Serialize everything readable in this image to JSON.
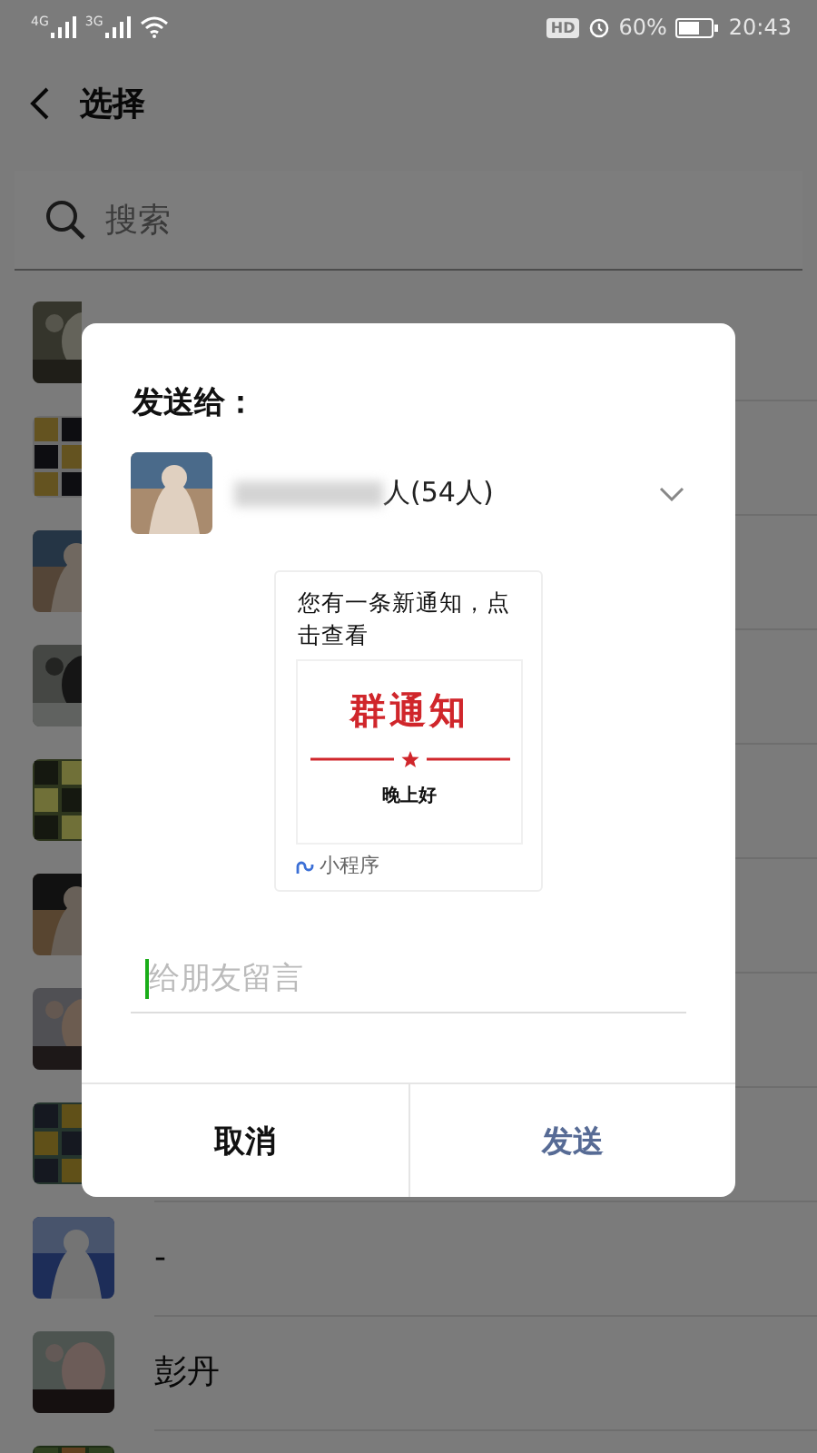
{
  "status_bar": {
    "networks": [
      {
        "label": "4G"
      },
      {
        "label": "3G"
      }
    ],
    "hd": "HD",
    "battery": "60%",
    "time": "20:43"
  },
  "header": {
    "title": "选择"
  },
  "search": {
    "placeholder": "搜索"
  },
  "contacts": [
    {
      "avatar": {
        "kind": "picture"
      }
    },
    {
      "avatar": {
        "kind": "picture"
      }
    },
    {
      "avatar": {
        "kind": "picture"
      }
    },
    {
      "avatar": {
        "kind": "picture"
      }
    },
    {
      "avatar": {
        "kind": "picture"
      }
    },
    {
      "avatar": {
        "kind": "picture"
      }
    },
    {
      "avatar": {
        "kind": "picture"
      }
    },
    {
      "avatar": {
        "kind": "picture"
      }
    },
    {
      "avatar": {
        "kind": "picture"
      },
      "name": "-"
    },
    {
      "avatar": {
        "kind": "picture"
      },
      "name": "彭丹"
    },
    {
      "avatar": {
        "kind": "picture"
      }
    }
  ],
  "dialog": {
    "title": "发送给：",
    "recipient": {
      "avatar": {
        "kind": "picture"
      },
      "name": "人(54人)"
    },
    "card": {
      "title": "您有一条新通知，点击查看",
      "cover": {
        "heading": "群通知",
        "greeting": "晚上好"
      },
      "source": "小程序"
    },
    "message": {
      "placeholder": "给朋友留言"
    },
    "buttons": [
      {
        "label": "取消",
        "kind": "cancel"
      },
      {
        "label": "发送",
        "kind": "confirm"
      }
    ]
  }
}
